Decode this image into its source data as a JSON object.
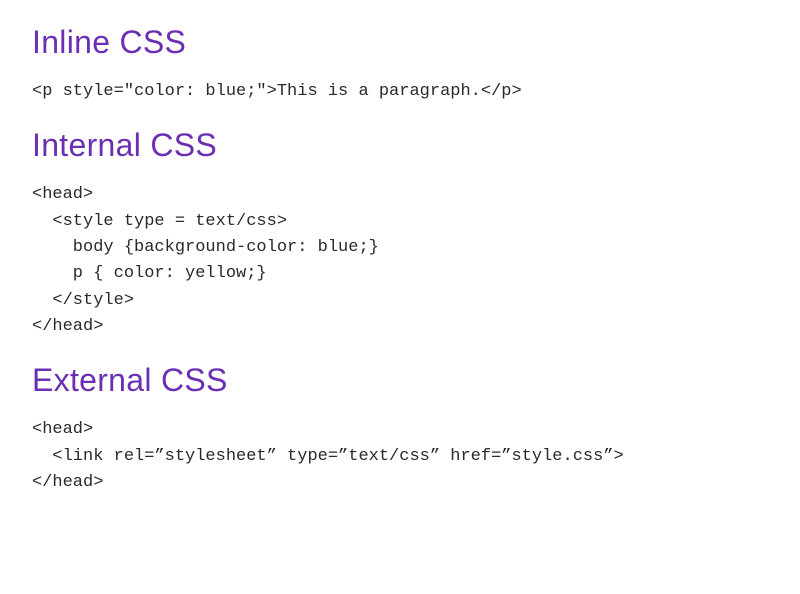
{
  "sections": [
    {
      "heading": "Inline CSS",
      "code": "<p style=\"color: blue;\">This is a paragraph.</p>"
    },
    {
      "heading": "Internal CSS",
      "code": "<head>\n  <style type = text/css>\n    body {background-color: blue;}\n    p { color: yellow;}\n  </style>\n</head>"
    },
    {
      "heading": "External CSS",
      "code": "<head>\n  <link rel=”stylesheet” type=”text/css” href=”style.css”>\n</head>"
    }
  ]
}
